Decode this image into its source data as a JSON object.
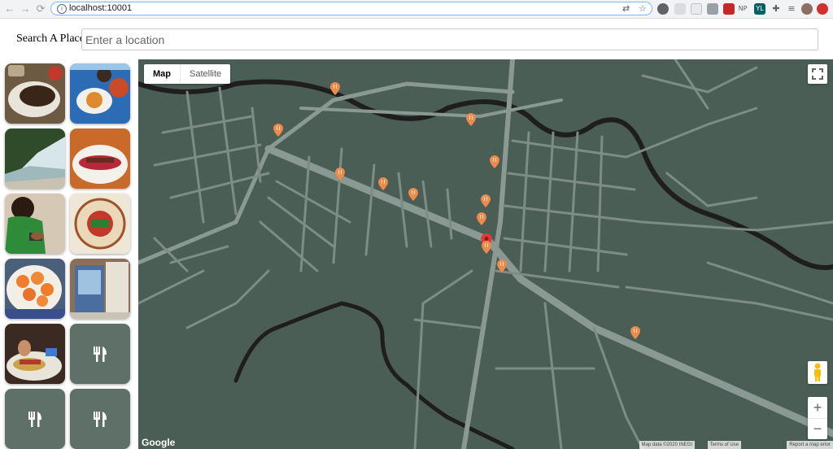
{
  "browser": {
    "url": "localhost:10001",
    "extensions": [
      "NP",
      "YL"
    ]
  },
  "search": {
    "label": "Search A Place",
    "placeholder": "Enter a location"
  },
  "gallery": {
    "photos": [
      "food-plate",
      "food-table",
      "beach-scene",
      "food-dish",
      "person-phone",
      "taqueria-sign",
      "shrimp-plate",
      "restaurant-storefront",
      "tacos"
    ],
    "placeholders": 3,
    "placeholder_icon": "fork-knife-icon"
  },
  "map": {
    "type_control": {
      "map_label": "Map",
      "satellite_label": "Satellite",
      "selected": "Map"
    },
    "zoom_in": "+",
    "zoom_out": "−",
    "logo": "Google",
    "attribution": [
      "Map data ©2020 INEGI",
      "Terms of Use",
      "Report a map error"
    ],
    "colors": {
      "background": "#4b5e56",
      "roads": "#8a9993",
      "river": "#1f1f1f",
      "pin": "#f08a4b",
      "selected_pin": "#e53935"
    },
    "restaurant_pins": 14,
    "selected_pins": 1
  }
}
